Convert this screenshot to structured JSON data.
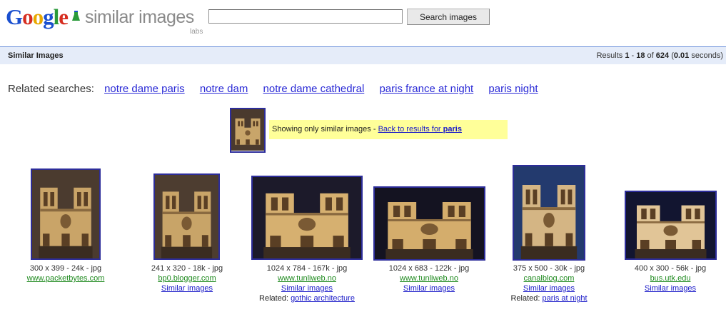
{
  "logo": {
    "word": [
      "G",
      "o",
      "o",
      "g",
      "l",
      "e"
    ],
    "subtitle": "similar images",
    "labs": "labs"
  },
  "search": {
    "value": "",
    "button_label": "Search images"
  },
  "bar": {
    "title": "Similar Images",
    "results_prefix": "Results ",
    "results_from": "1",
    "results_sep": " - ",
    "results_to": "18",
    "results_of": " of ",
    "results_total": "624",
    "results_time_open": " (",
    "results_time": "0.01",
    "results_time_close": " seconds)"
  },
  "related": {
    "label": "Related searches:",
    "links": [
      "notre dame paris",
      "notre dam",
      "notre dame cathedral",
      "paris france at night",
      "paris night"
    ]
  },
  "notice": {
    "text": "Showing only similar images - ",
    "link_prefix": "Back to results for ",
    "link_term": "paris"
  },
  "results": [
    {
      "dims": "300 x 399 - 24k - jpg",
      "site": "www.packetbytes.com",
      "similar": "",
      "related_label": "",
      "related_link": ""
    },
    {
      "dims": "241 x 320 - 18k - jpg",
      "site": "bp0.blogger.com",
      "similar": "Similar images",
      "related_label": "",
      "related_link": ""
    },
    {
      "dims": "1024 x 784 - 167k - jpg",
      "site": "www.tunliweb.no",
      "similar": "Similar images",
      "related_label": "Related: ",
      "related_link": "gothic architecture"
    },
    {
      "dims": "1024 x 683 - 122k - jpg",
      "site": "www.tunliweb.no",
      "similar": "Similar images",
      "related_label": "",
      "related_link": ""
    },
    {
      "dims": "375 x 500 - 30k - jpg",
      "site": "canalblog.com",
      "similar": "Similar images",
      "related_label": "Related: ",
      "related_link": "paris at night"
    },
    {
      "dims": "400 x 300 - 56k - jpg",
      "site": "bus.utk.edu",
      "similar": "Similar images",
      "related_label": "",
      "related_link": ""
    }
  ],
  "colors": {
    "bar_bg": "#e5ecf9",
    "link": "#1a1ac8",
    "site_green": "#1f8a1f",
    "notice_bg": "#ffff99",
    "thumb_border": "#2d2d9a"
  }
}
